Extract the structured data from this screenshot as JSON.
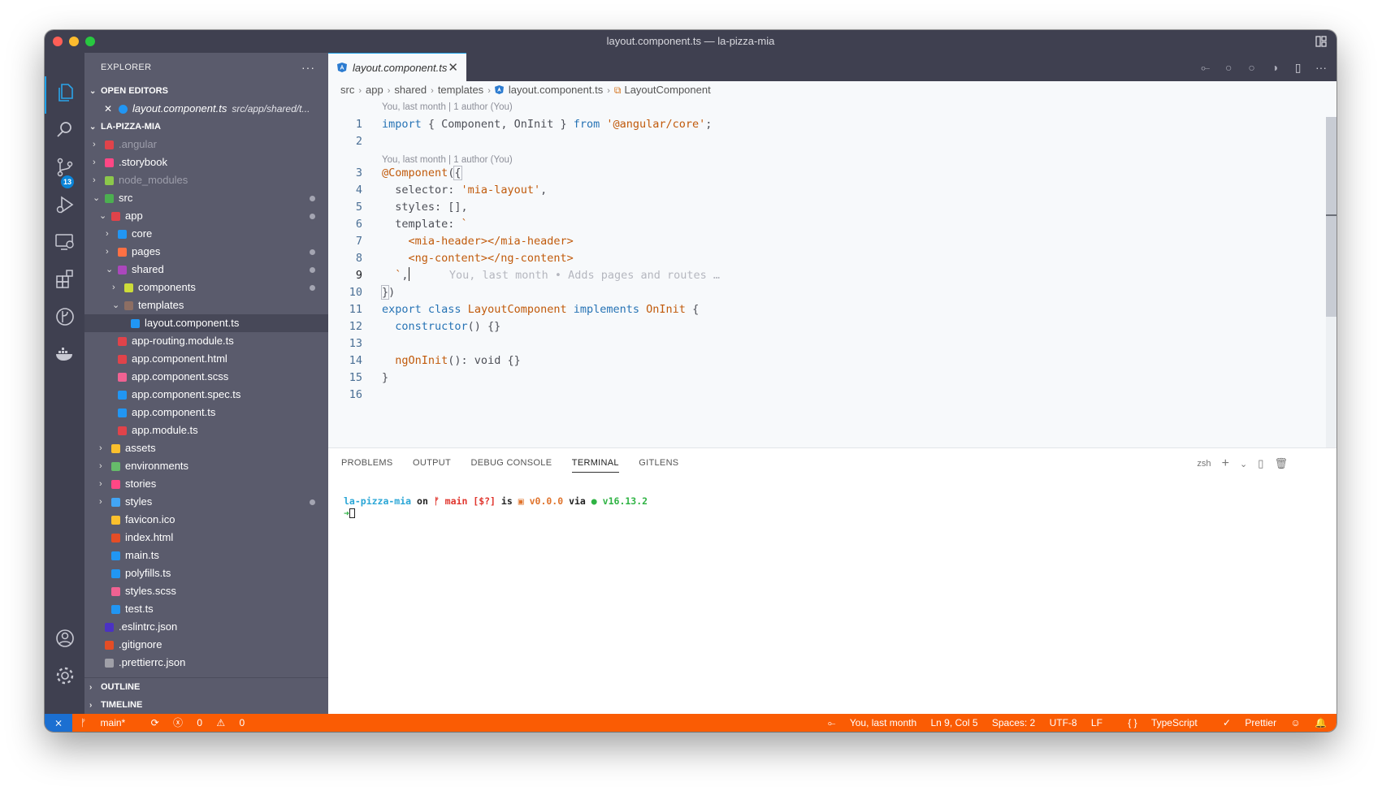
{
  "window": {
    "title": "layout.component.ts — la-pizza-mia"
  },
  "activity": {
    "scm_badge": "13"
  },
  "explorer": {
    "header": "EXPLORER",
    "more": "···",
    "open_editors_title": "OPEN EDITORS",
    "open_editor": {
      "name": "layout.component.ts",
      "path": "src/app/shared/t..."
    },
    "project_title": "LA-PIZZA-MIA",
    "items": [
      {
        "label": ".angular",
        "dim": true,
        "color": "#e0434a"
      },
      {
        "label": ".storybook",
        "color": "#ff4785"
      },
      {
        "label": "node_modules",
        "dim": true,
        "color": "#8cc84b"
      },
      {
        "label": "src",
        "color": "#4caf50"
      },
      {
        "label": "app",
        "color": "#e0434a"
      },
      {
        "label": "core",
        "color": "#2196f3"
      },
      {
        "label": "pages",
        "color": "#ff7043"
      },
      {
        "label": "shared",
        "color": "#ab47bc"
      },
      {
        "label": "components",
        "color": "#cddc39"
      },
      {
        "label": "templates",
        "color": "#8d6e63"
      },
      {
        "label": "layout.component.ts",
        "color": "#2196f3"
      },
      {
        "label": "app-routing.module.ts",
        "color": "#e0434a"
      },
      {
        "label": "app.component.html",
        "color": "#e0434a"
      },
      {
        "label": "app.component.scss",
        "color": "#f06292"
      },
      {
        "label": "app.component.spec.ts",
        "color": "#2196f3"
      },
      {
        "label": "app.component.ts",
        "color": "#2196f3"
      },
      {
        "label": "app.module.ts",
        "color": "#e0434a"
      },
      {
        "label": "assets",
        "color": "#fbc02d"
      },
      {
        "label": "environments",
        "color": "#66bb6a"
      },
      {
        "label": "stories",
        "color": "#ff4785"
      },
      {
        "label": "styles",
        "color": "#42a5f5"
      },
      {
        "label": "favicon.ico",
        "color": "#fbc02d"
      },
      {
        "label": "index.html",
        "color": "#e44d26"
      },
      {
        "label": "main.ts",
        "color": "#2196f3"
      },
      {
        "label": "polyfills.ts",
        "color": "#2196f3"
      },
      {
        "label": "styles.scss",
        "color": "#f06292"
      },
      {
        "label": "test.ts",
        "color": "#2196f3"
      },
      {
        "label": ".eslintrc.json",
        "color": "#4b32c3"
      },
      {
        "label": ".gitignore",
        "color": "#e44d26"
      },
      {
        "label": ".prettierrc.json",
        "color": "#a0a0a8"
      }
    ],
    "outline_title": "OUTLINE",
    "timeline_title": "TIMELINE"
  },
  "editor": {
    "tab_label": "layout.component.ts",
    "tab_close": "✕",
    "breadcrumb": [
      "src",
      "app",
      "shared",
      "templates",
      "layout.component.ts",
      "LayoutComponent"
    ],
    "codelens": "You, last month | 1 author (You)",
    "codelens2": "You, last month | 1 author (You)",
    "blame_inline": "You, last month • Adds pages and routes …",
    "line_numbers": [
      "1",
      "2",
      "3",
      "4",
      "5",
      "6",
      "7",
      "8",
      "9",
      "10",
      "11",
      "12",
      "13",
      "14",
      "15",
      "16"
    ]
  },
  "panel": {
    "tabs": [
      "PROBLEMS",
      "OUTPUT",
      "DEBUG CONSOLE",
      "TERMINAL",
      "GITLENS"
    ],
    "shell": "zsh",
    "terminal": {
      "dir": "la-pizza-mia",
      "on": "on",
      "branch": "main [$?]",
      "is": "is",
      "version": "v0.0.0",
      "via": "via",
      "node": "v16.13.2"
    }
  },
  "status": {
    "branch": "main*",
    "errors": "0",
    "warnings": "0",
    "blame": "You, last month",
    "position": "Ln 9, Col 5",
    "spaces": "Spaces: 2",
    "encoding": "UTF-8",
    "eol": "LF",
    "language": "TypeScript",
    "formatter": "Prettier"
  }
}
